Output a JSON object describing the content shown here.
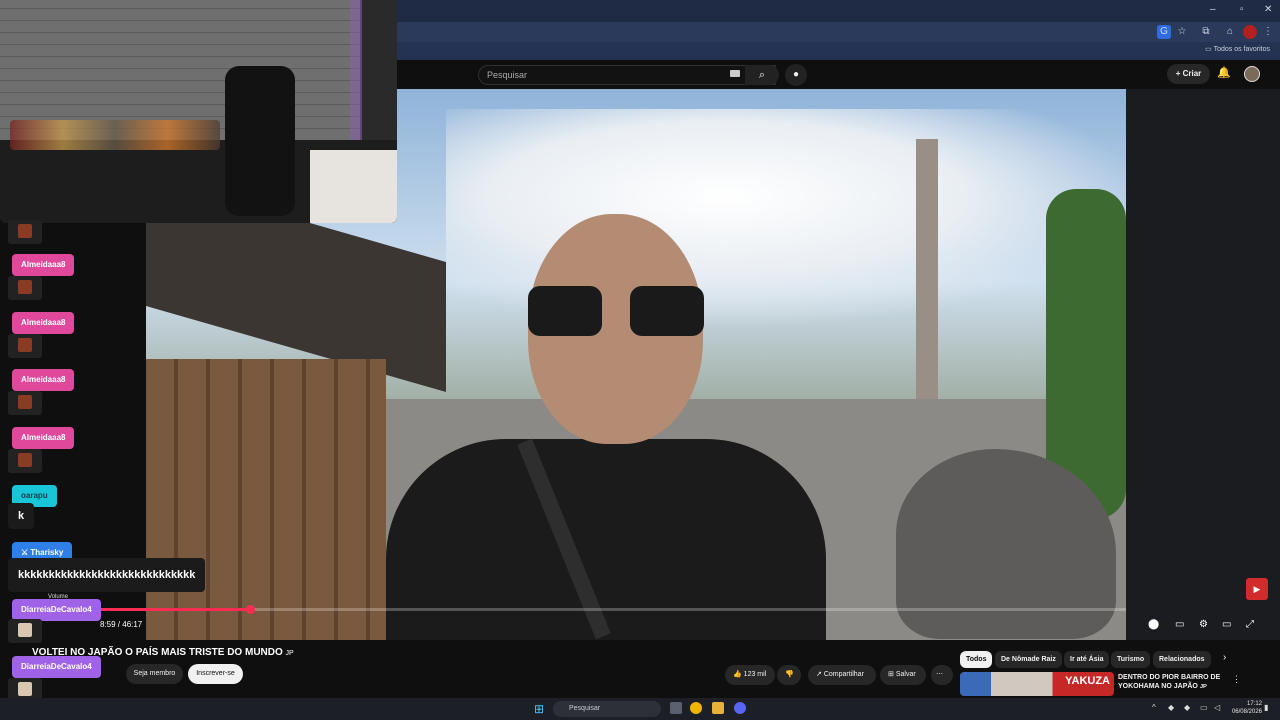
{
  "browser": {
    "bookmarks_folder": "Todos os favoritos"
  },
  "youtube_header": {
    "search_placeholder": "Pesquisar",
    "create_label": "Criar"
  },
  "player": {
    "timecode": "8:59 / 46:17",
    "volume_label": "Volume",
    "progress_fraction": 0.194
  },
  "video": {
    "title": "VOLTEI NO JAPÃO O PAÍS MAIS TRISTE DO MUNDO",
    "title_flag": "JP"
  },
  "channel": {
    "join_label": "Seja membro",
    "subscribe_label": "Inscrever-se"
  },
  "actions": {
    "likes": "123 mil",
    "share_label": "Compartilhar",
    "save_label": "Salvar"
  },
  "chips": [
    {
      "label": "Todos"
    },
    {
      "label": "De Nômade Raiz"
    },
    {
      "label": "Ir até Ásia"
    },
    {
      "label": "Turismo"
    },
    {
      "label": "Relacionados"
    }
  ],
  "recommendation": {
    "thumb_text": "YAKUZA",
    "title": "DENTRO DO PIOR BAIRRO DE YOKOHAMA NO JAPÃO",
    "title_flag": "JP"
  },
  "chat": {
    "messages": [
      {
        "user": "Almeidaaa8",
        "color": "#e0489c"
      },
      {
        "user": "Almeidaaa8",
        "color": "#e0489c"
      },
      {
        "user": "Almeidaaa8",
        "color": "#e0489c"
      },
      {
        "user": "Almeidaaa8",
        "color": "#e0489c"
      },
      {
        "user": "oarapu",
        "color": "#18c6d8",
        "text": "k"
      },
      {
        "user": "Tharisky",
        "color": "#2f7fe8",
        "text": "kkkkkkkkkkkkkkkkkkkkkkkkkkkkk"
      },
      {
        "user": "DiarreiaDeCavalo4",
        "color": "#a063e8"
      },
      {
        "user": "DiarreiaDeCavalo4",
        "color": "#a063e8"
      }
    ]
  },
  "taskbar": {
    "search_placeholder": "Pesquisar",
    "time": "17:12",
    "date": "06/08/2026"
  }
}
